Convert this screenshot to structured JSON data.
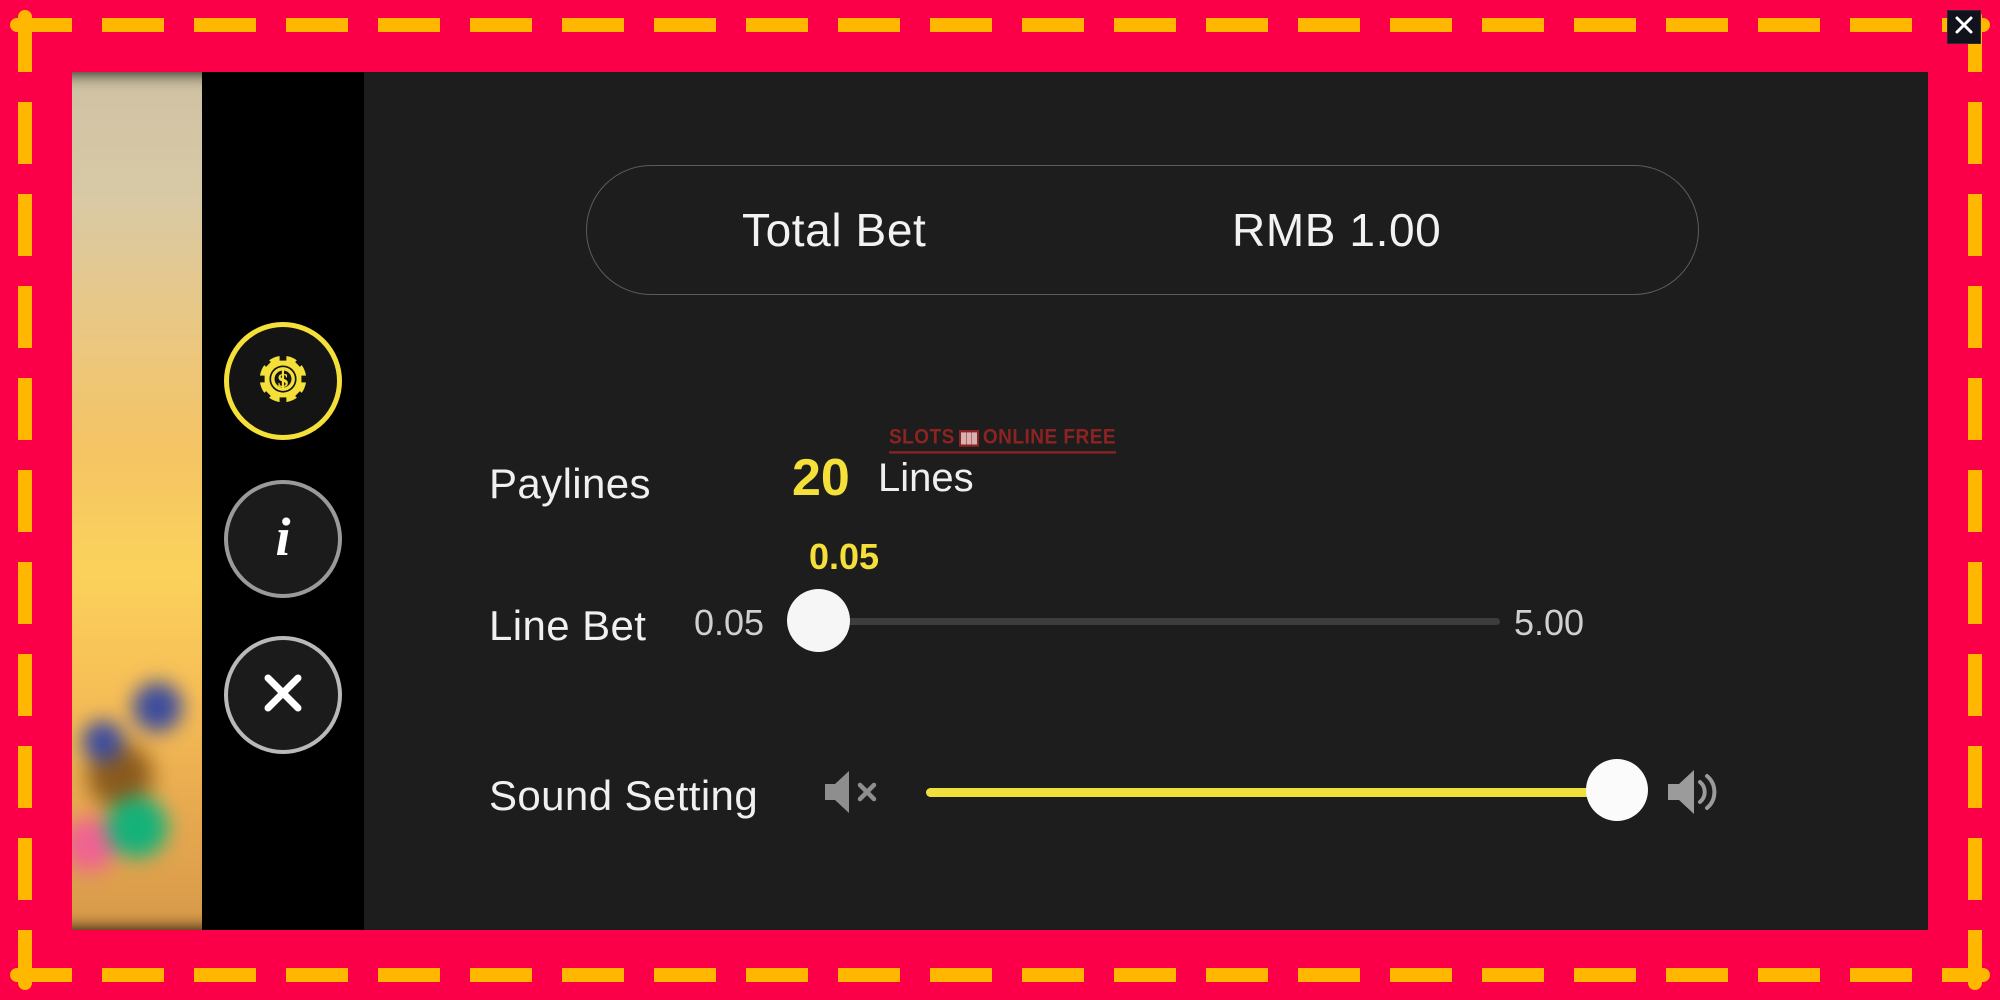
{
  "frame": {
    "background_color": "#fb0048",
    "dash_color": "#ffb700"
  },
  "window": {
    "close_button_label": "✕"
  },
  "side_rail": {
    "items": [
      {
        "name": "bet-settings",
        "icon": "casino-chip-icon",
        "active": true,
        "accent": "#f5e03a"
      },
      {
        "name": "info",
        "icon": "info-icon",
        "active": false,
        "accent": "#9a9a9a",
        "glyph": "i"
      },
      {
        "name": "close",
        "icon": "close-icon",
        "active": false,
        "accent": "#b9b9b9"
      }
    ]
  },
  "panel": {
    "total_bet": {
      "label": "Total Bet",
      "value": "RMB 1.00"
    },
    "paylines": {
      "label": "Paylines",
      "count": "20",
      "unit": "Lines"
    },
    "line_bet": {
      "label": "Line Bet",
      "current": "0.05",
      "min": "0.05",
      "max": "5.00",
      "fill_percent": 0
    },
    "sound_setting": {
      "label": "Sound Setting",
      "mute_icon": "speaker-mute-icon",
      "volume_icon": "speaker-volume-icon",
      "fill_percent": 100,
      "track_color": "#f0e03c"
    }
  },
  "watermark": {
    "left_text": "SLOTS",
    "right_text": "ONLINE FREE",
    "color": "#8d2321"
  }
}
